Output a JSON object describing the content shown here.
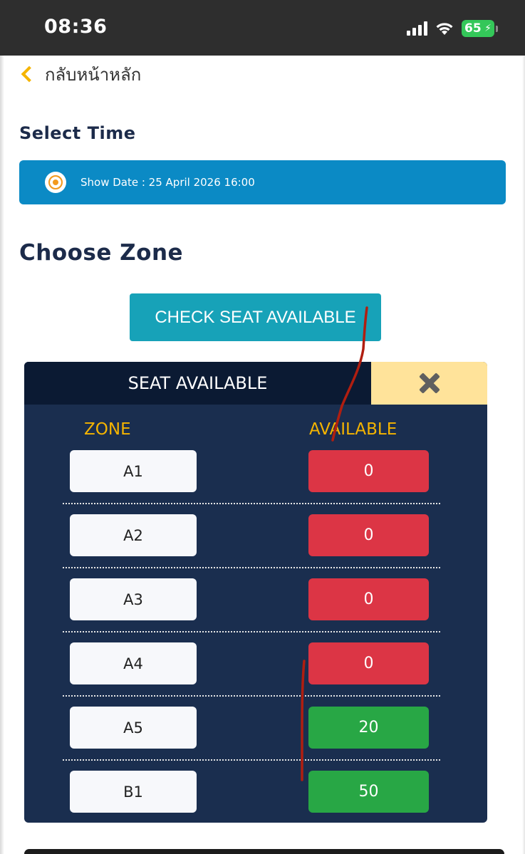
{
  "status_bar": {
    "time": "08:36",
    "battery": "65"
  },
  "nav": {
    "back_label": "กลับหน้าหลัก"
  },
  "select_time": {
    "heading": "Select Time",
    "option_label": "Show Date : 25 April 2026 16:00"
  },
  "choose_zone": {
    "heading": "Choose Zone",
    "check_button": "CHECK SEAT AVAILABLE"
  },
  "modal": {
    "title": "SEAT AVAILABLE",
    "col_zone": "ZONE",
    "col_available": "AVAILABLE",
    "rows": [
      {
        "zone": "A1",
        "available": "0",
        "status_color": "#dc3545"
      },
      {
        "zone": "A2",
        "available": "0",
        "status_color": "#dc3545"
      },
      {
        "zone": "A3",
        "available": "0",
        "status_color": "#dc3545"
      },
      {
        "zone": "A4",
        "available": "0",
        "status_color": "#dc3545"
      },
      {
        "zone": "A5",
        "available": "20",
        "status_color": "#28a745"
      },
      {
        "zone": "B1",
        "available": "50",
        "status_color": "#28a745"
      }
    ]
  },
  "colors": {
    "accent_blue": "#0b8ac5",
    "button_teal": "#17a2b8",
    "modal_bg": "#1a2e4f",
    "header_yellow": "#f5b400",
    "annotation_red": "#b01e10"
  }
}
